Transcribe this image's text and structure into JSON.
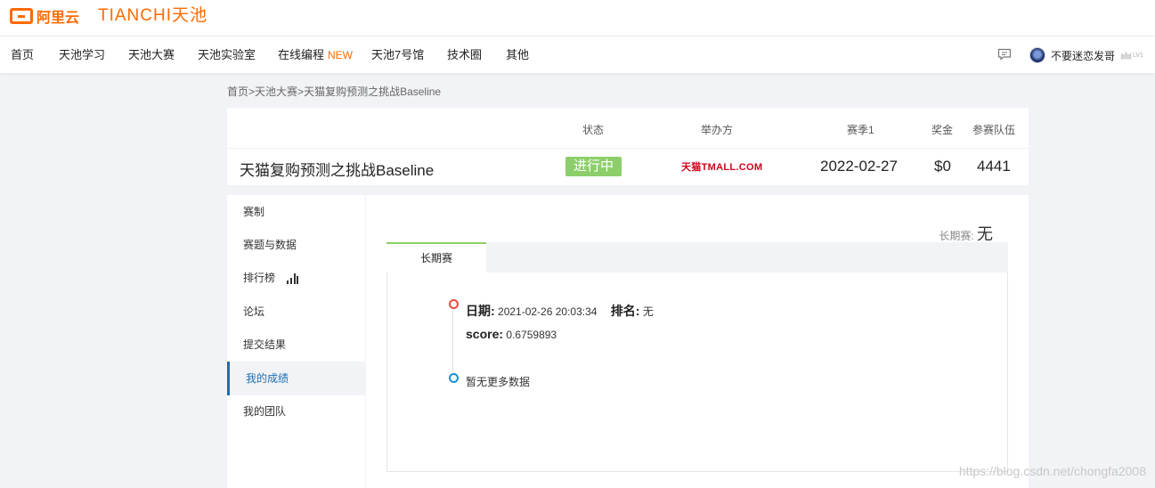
{
  "brand": {
    "aliyun": "阿里云",
    "tianchi": "TIANCHI天池"
  },
  "nav": {
    "items": [
      {
        "label": "首页"
      },
      {
        "label": "天池学习"
      },
      {
        "label": "天池大赛"
      },
      {
        "label": "天池实验室"
      },
      {
        "label": "在线编程",
        "badge": "NEW"
      },
      {
        "label": "天池7号馆"
      },
      {
        "label": "技术圈"
      },
      {
        "label": "其他"
      }
    ],
    "user_name": "不要迷恋发哥",
    "user_level": "LV1"
  },
  "breadcrumb": [
    "首页",
    "天池大赛",
    "天猫复购预测之挑战Baseline"
  ],
  "competition": {
    "headers": {
      "status": "状态",
      "organizer": "举办方",
      "season": "赛季1",
      "prize": "奖金",
      "teams": "参赛队伍"
    },
    "title": "天猫复购预测之挑战Baseline",
    "status": "进行中",
    "organizer": "天猫TMALL.COM",
    "season_date": "2022-02-27",
    "prize": "$0",
    "teams": "4441",
    "status_color": "#8ccf6a"
  },
  "sidebar": {
    "items": [
      {
        "label": "赛制"
      },
      {
        "label": "赛题与数据"
      },
      {
        "label": "排行榜"
      },
      {
        "label": "论坛"
      },
      {
        "label": "提交结果"
      },
      {
        "label": "我的成绩"
      },
      {
        "label": "我的团队"
      }
    ],
    "active": "我的成绩"
  },
  "main": {
    "long_term_label": "长期赛:",
    "long_term_value": "无",
    "tab": "长期赛",
    "record": {
      "date_label": "日期:",
      "date_value": "2021-02-26 20:03:34",
      "rank_label": "排名:",
      "rank_value": "无",
      "score_label": "score:",
      "score_value": "0.6759893"
    },
    "no_more": "暂无更多数据"
  },
  "watermark": "https://blog.csdn.net/chongfa2008"
}
